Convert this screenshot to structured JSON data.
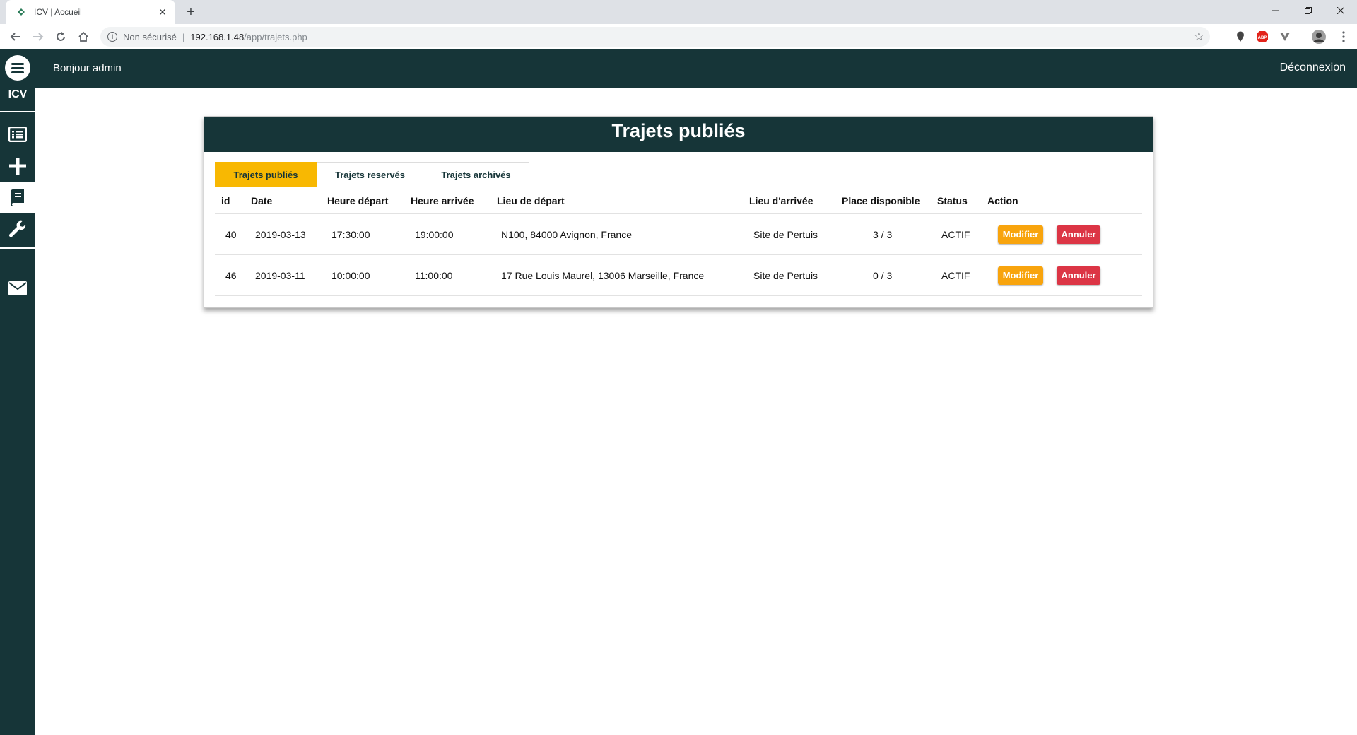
{
  "browser": {
    "tab_title": "ICV | Accueil",
    "security_label": "Non sécurisé",
    "url_host": "192.168.1.48",
    "url_path": "/app/trajets.php"
  },
  "app": {
    "brand": "ICV",
    "greeting": "Bonjour admin",
    "logout": "Déconnexion"
  },
  "panel": {
    "title": "Trajets publiés",
    "tabs": [
      {
        "label": "Trajets publiés",
        "active": true
      },
      {
        "label": "Trajets reservés",
        "active": false
      },
      {
        "label": "Trajets archivés",
        "active": false
      }
    ]
  },
  "table": {
    "headers": [
      "id",
      "Date",
      "Heure départ",
      "Heure arrivée",
      "Lieu de départ",
      "Lieu d'arrivée",
      "Place disponible",
      "Status",
      "Action"
    ],
    "rows": [
      {
        "id": "40",
        "date": "2019-03-13",
        "depart": "17:30:00",
        "arrivee": "19:00:00",
        "lieu_depart": "N100, 84000 Avignon, France",
        "lieu_arrivee": "Site de Pertuis",
        "places": "3 / 3",
        "status": "ACTIF"
      },
      {
        "id": "46",
        "date": "2019-03-11",
        "depart": "10:00:00",
        "arrivee": "11:00:00",
        "lieu_depart": "17 Rue Louis Maurel, 13006 Marseille, France",
        "lieu_arrivee": "Site de Pertuis",
        "places": "0 / 3",
        "status": "ACTIF"
      }
    ],
    "btn_modify": "Modifier",
    "btn_cancel": "Annuler"
  },
  "colors": {
    "primary": "#163538",
    "tab_active": "#f8b802",
    "modify": "#f8a40d",
    "cancel": "#dc3545"
  },
  "icons": {
    "sidebar": [
      "menu-icon",
      "list-icon",
      "plus-icon",
      "book-icon",
      "wrench-icon",
      "envelope-icon"
    ]
  }
}
